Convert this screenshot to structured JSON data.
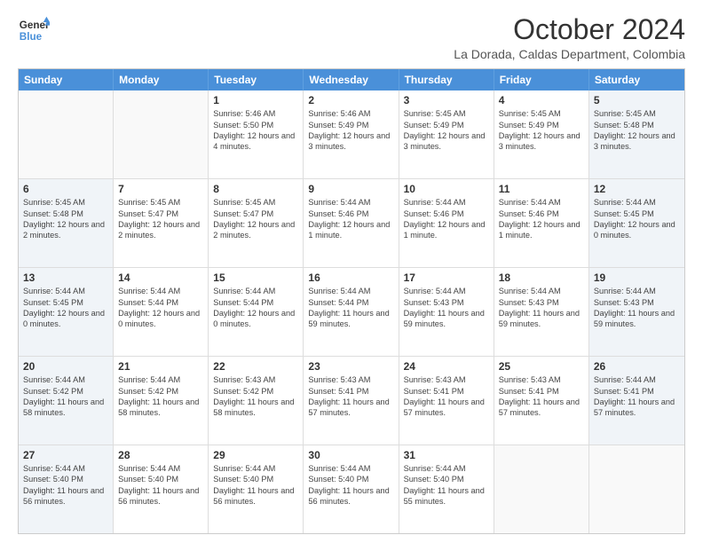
{
  "header": {
    "logo_line1": "General",
    "logo_line2": "Blue",
    "title": "October 2024",
    "subtitle": "La Dorada, Caldas Department, Colombia"
  },
  "days_of_week": [
    "Sunday",
    "Monday",
    "Tuesday",
    "Wednesday",
    "Thursday",
    "Friday",
    "Saturday"
  ],
  "weeks": [
    [
      {
        "day": "",
        "info": "",
        "empty": true
      },
      {
        "day": "",
        "info": "",
        "empty": true
      },
      {
        "day": "1",
        "info": "Sunrise: 5:46 AM\nSunset: 5:50 PM\nDaylight: 12 hours and 4 minutes."
      },
      {
        "day": "2",
        "info": "Sunrise: 5:46 AM\nSunset: 5:49 PM\nDaylight: 12 hours and 3 minutes."
      },
      {
        "day": "3",
        "info": "Sunrise: 5:45 AM\nSunset: 5:49 PM\nDaylight: 12 hours and 3 minutes."
      },
      {
        "day": "4",
        "info": "Sunrise: 5:45 AM\nSunset: 5:49 PM\nDaylight: 12 hours and 3 minutes."
      },
      {
        "day": "5",
        "info": "Sunrise: 5:45 AM\nSunset: 5:48 PM\nDaylight: 12 hours and 3 minutes."
      }
    ],
    [
      {
        "day": "6",
        "info": "Sunrise: 5:45 AM\nSunset: 5:48 PM\nDaylight: 12 hours and 2 minutes."
      },
      {
        "day": "7",
        "info": "Sunrise: 5:45 AM\nSunset: 5:47 PM\nDaylight: 12 hours and 2 minutes."
      },
      {
        "day": "8",
        "info": "Sunrise: 5:45 AM\nSunset: 5:47 PM\nDaylight: 12 hours and 2 minutes."
      },
      {
        "day": "9",
        "info": "Sunrise: 5:44 AM\nSunset: 5:46 PM\nDaylight: 12 hours and 1 minute."
      },
      {
        "day": "10",
        "info": "Sunrise: 5:44 AM\nSunset: 5:46 PM\nDaylight: 12 hours and 1 minute."
      },
      {
        "day": "11",
        "info": "Sunrise: 5:44 AM\nSunset: 5:46 PM\nDaylight: 12 hours and 1 minute."
      },
      {
        "day": "12",
        "info": "Sunrise: 5:44 AM\nSunset: 5:45 PM\nDaylight: 12 hours and 0 minutes."
      }
    ],
    [
      {
        "day": "13",
        "info": "Sunrise: 5:44 AM\nSunset: 5:45 PM\nDaylight: 12 hours and 0 minutes."
      },
      {
        "day": "14",
        "info": "Sunrise: 5:44 AM\nSunset: 5:44 PM\nDaylight: 12 hours and 0 minutes."
      },
      {
        "day": "15",
        "info": "Sunrise: 5:44 AM\nSunset: 5:44 PM\nDaylight: 12 hours and 0 minutes."
      },
      {
        "day": "16",
        "info": "Sunrise: 5:44 AM\nSunset: 5:44 PM\nDaylight: 11 hours and 59 minutes."
      },
      {
        "day": "17",
        "info": "Sunrise: 5:44 AM\nSunset: 5:43 PM\nDaylight: 11 hours and 59 minutes."
      },
      {
        "day": "18",
        "info": "Sunrise: 5:44 AM\nSunset: 5:43 PM\nDaylight: 11 hours and 59 minutes."
      },
      {
        "day": "19",
        "info": "Sunrise: 5:44 AM\nSunset: 5:43 PM\nDaylight: 11 hours and 59 minutes."
      }
    ],
    [
      {
        "day": "20",
        "info": "Sunrise: 5:44 AM\nSunset: 5:42 PM\nDaylight: 11 hours and 58 minutes."
      },
      {
        "day": "21",
        "info": "Sunrise: 5:44 AM\nSunset: 5:42 PM\nDaylight: 11 hours and 58 minutes."
      },
      {
        "day": "22",
        "info": "Sunrise: 5:43 AM\nSunset: 5:42 PM\nDaylight: 11 hours and 58 minutes."
      },
      {
        "day": "23",
        "info": "Sunrise: 5:43 AM\nSunset: 5:41 PM\nDaylight: 11 hours and 57 minutes."
      },
      {
        "day": "24",
        "info": "Sunrise: 5:43 AM\nSunset: 5:41 PM\nDaylight: 11 hours and 57 minutes."
      },
      {
        "day": "25",
        "info": "Sunrise: 5:43 AM\nSunset: 5:41 PM\nDaylight: 11 hours and 57 minutes."
      },
      {
        "day": "26",
        "info": "Sunrise: 5:44 AM\nSunset: 5:41 PM\nDaylight: 11 hours and 57 minutes."
      }
    ],
    [
      {
        "day": "27",
        "info": "Sunrise: 5:44 AM\nSunset: 5:40 PM\nDaylight: 11 hours and 56 minutes."
      },
      {
        "day": "28",
        "info": "Sunrise: 5:44 AM\nSunset: 5:40 PM\nDaylight: 11 hours and 56 minutes."
      },
      {
        "day": "29",
        "info": "Sunrise: 5:44 AM\nSunset: 5:40 PM\nDaylight: 11 hours and 56 minutes."
      },
      {
        "day": "30",
        "info": "Sunrise: 5:44 AM\nSunset: 5:40 PM\nDaylight: 11 hours and 56 minutes."
      },
      {
        "day": "31",
        "info": "Sunrise: 5:44 AM\nSunset: 5:40 PM\nDaylight: 11 hours and 55 minutes."
      },
      {
        "day": "",
        "info": "",
        "empty": true
      },
      {
        "day": "",
        "info": "",
        "empty": true
      }
    ]
  ]
}
